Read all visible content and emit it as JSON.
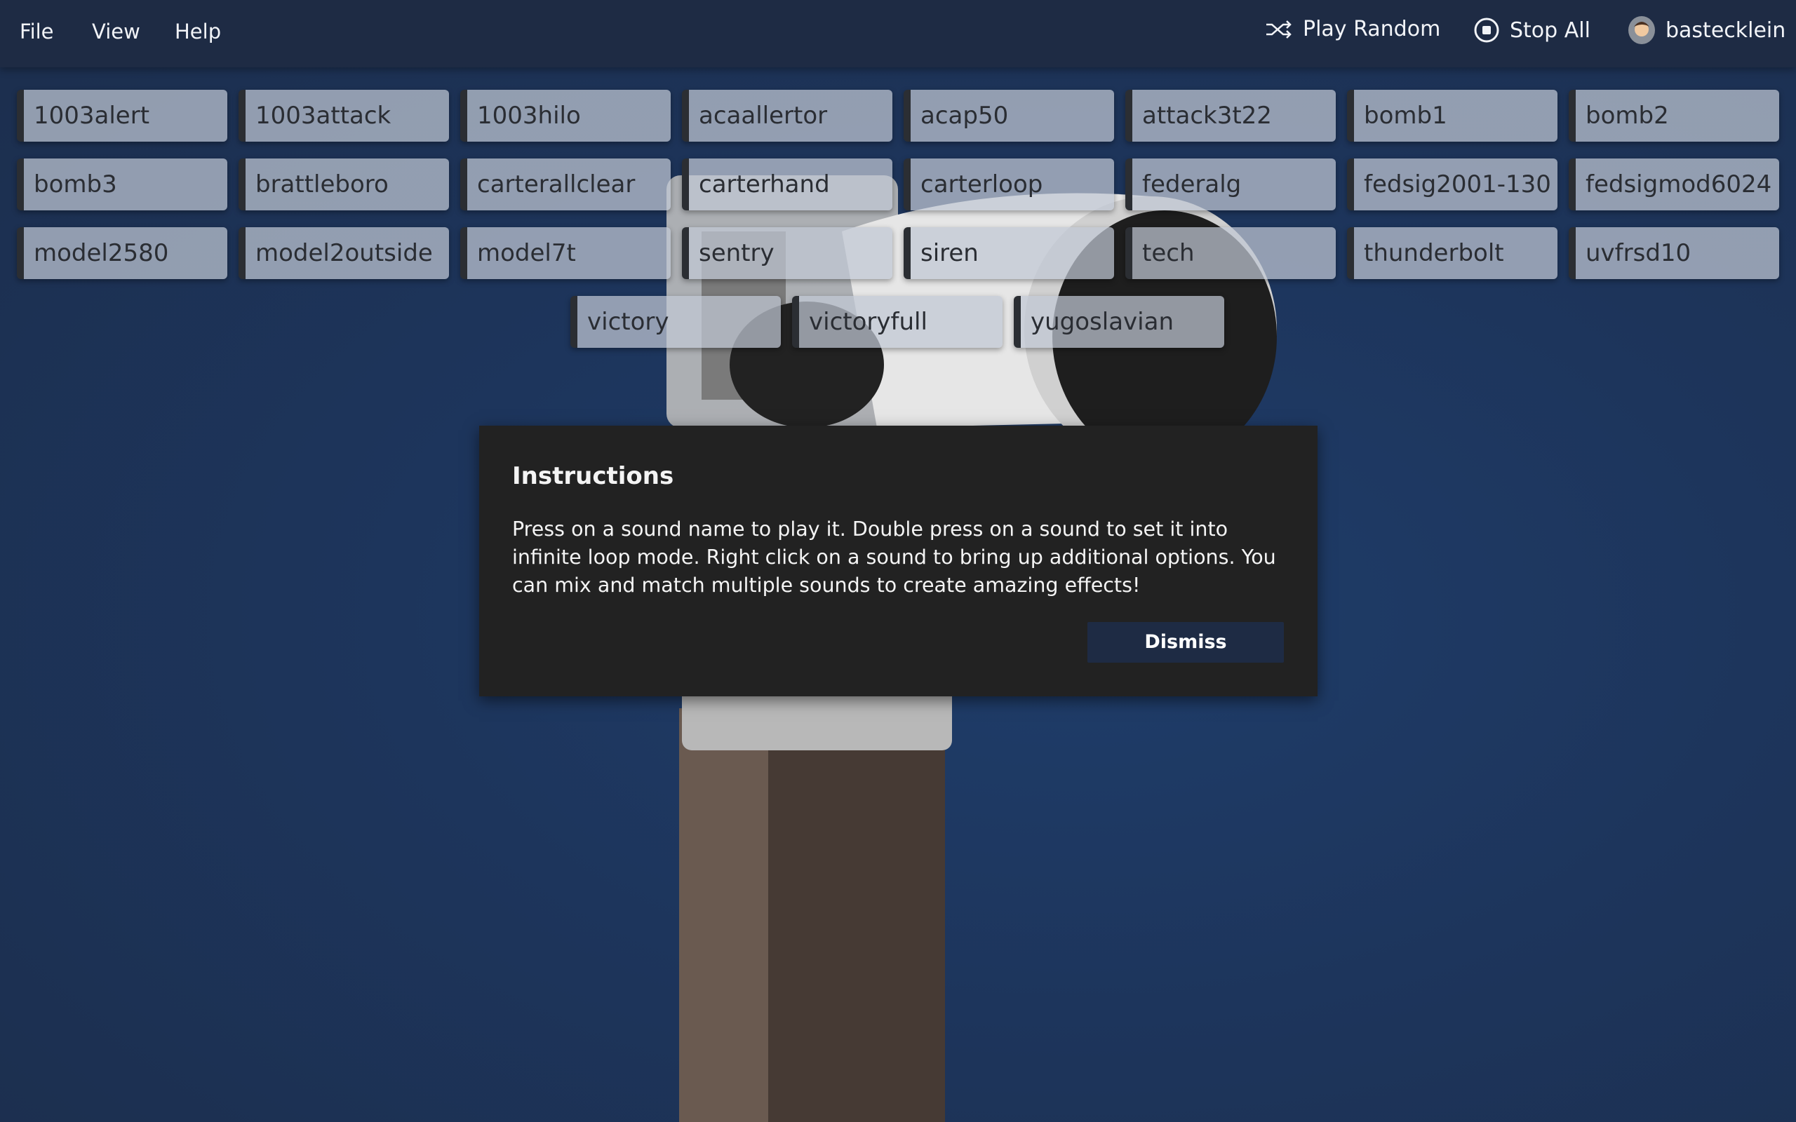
{
  "menu": {
    "file": "File",
    "view": "View",
    "help": "Help"
  },
  "toolbar": {
    "play_random": "Play Random",
    "stop_all": "Stop All",
    "username": "bastecklein"
  },
  "sounds": [
    "1003alert",
    "1003attack",
    "1003hilo",
    "acaallertor",
    "acap50",
    "attack3t22",
    "bomb1",
    "bomb2",
    "bomb3",
    "brattleboro",
    "carterallclear",
    "carterhand",
    "carterloop",
    "federalg",
    "fedsig2001-130",
    "fedsigmod6024",
    "model2580",
    "model2outside",
    "model7t",
    "sentry",
    "siren",
    "tech",
    "thunderbolt",
    "uvfrsd10",
    "victory",
    "victoryfull",
    "yugoslavian"
  ],
  "dialog": {
    "title": "Instructions",
    "body": "Press on a sound name to play it. Double press on a sound to set it into infinite loop mode. Right click on a sound to bring up additional options. You can mix and match multiple sounds to create amazing effects!",
    "dismiss": "Dismiss"
  },
  "colors": {
    "menubar": "#1e2b44",
    "dialog": "#222222",
    "accent": "#1e2b44"
  }
}
